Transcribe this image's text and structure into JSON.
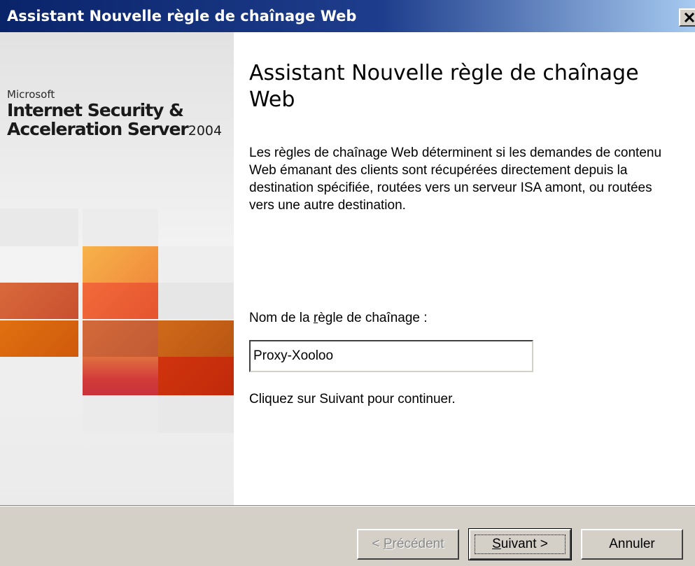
{
  "window": {
    "title": "Assistant Nouvelle règle de chaînage Web"
  },
  "branding": {
    "company": "Microsoft",
    "product_line1": "Internet Security &",
    "product_line2": "Acceleration Server",
    "version": "2004"
  },
  "content": {
    "heading": "Assistant Nouvelle règle de chaînage Web",
    "description": "Les règles de chaînage Web déterminent si les demandes de contenu Web émanant des clients sont récupérées directement depuis la destination spécifiée, routées vers un serveur ISA amont, ou routées vers une autre destination.",
    "name_label": "Nom de la règle de chaînage :",
    "name_value": "Proxy-Xooloo",
    "continue_hint": "Cliquez sur Suivant pour continuer."
  },
  "buttons": {
    "previous": "< Précédent",
    "next": "Suivant >",
    "cancel": "Annuler"
  },
  "icons": {
    "close": "close-x-icon"
  },
  "colors": {
    "titlebar_start": "#0a246a",
    "titlebar_end": "#a6caf0",
    "dialog_gray": "#d4d0c8"
  }
}
